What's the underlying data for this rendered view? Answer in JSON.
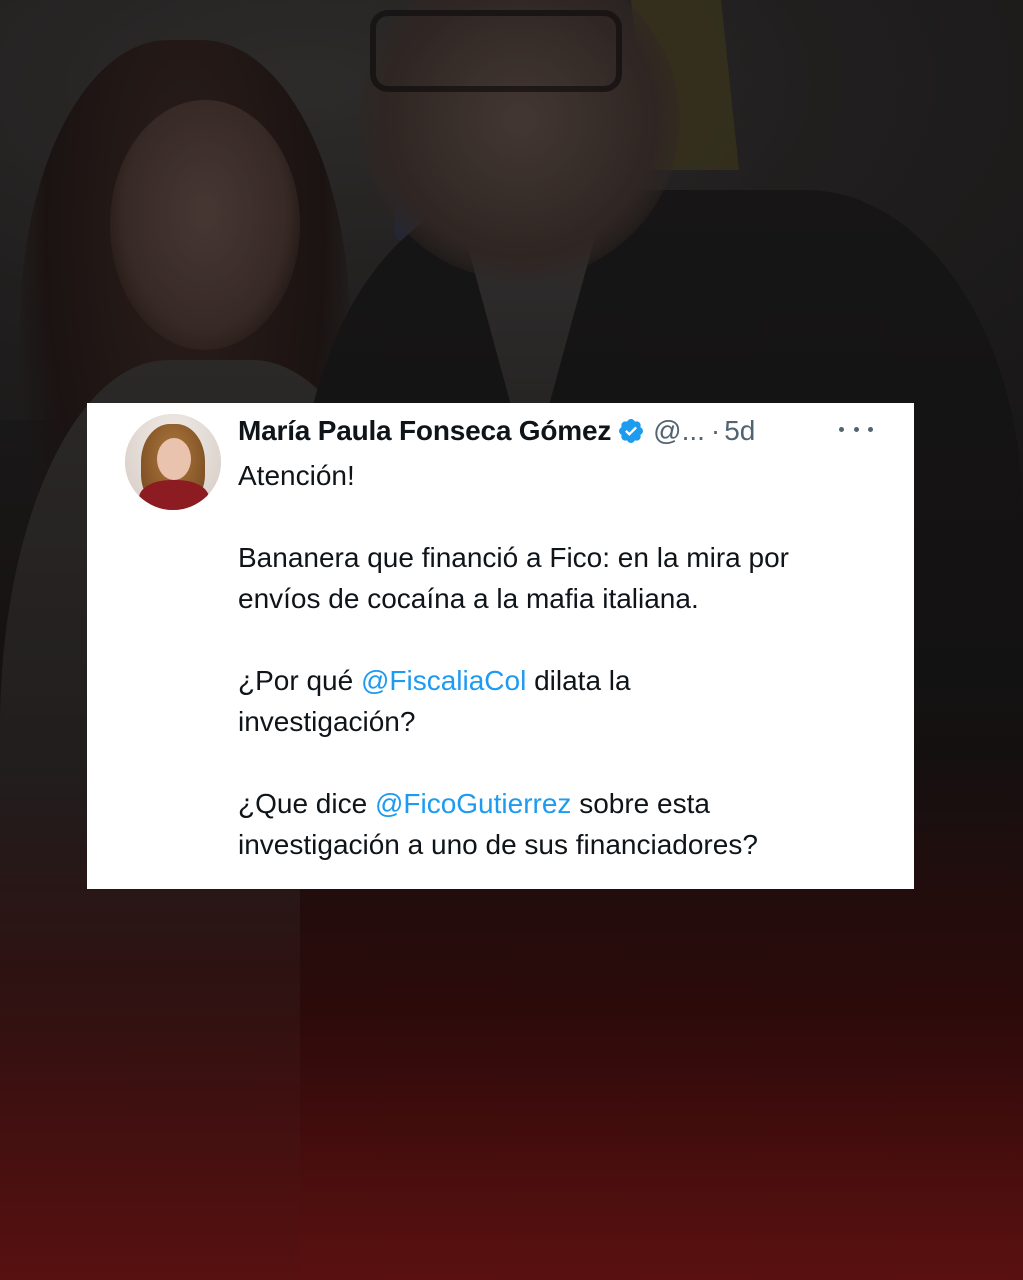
{
  "tweet": {
    "author_name": "María Paula Fonseca Gómez",
    "handle": "@...",
    "separator": "·",
    "time": "5d",
    "paragraphs": {
      "p1": "Atención!",
      "p2_line1": "Bananera que financió a Fico: en la mira por",
      "p2_line2": "envíos de cocaína a la mafia italiana.",
      "p3_pre": "¿Por qué ",
      "p3_mention": "@FiscaliaCol",
      "p3_post": " dilata la",
      "p3_line2": "investigación?",
      "p4_pre": "¿Que dice ",
      "p4_mention": "@FicoGutierrez",
      "p4_post": " sobre esta",
      "p4_line2": "investigación a uno de sus financiadores?"
    },
    "icons": {
      "verified": "verified-badge-icon",
      "more": "more-options-icon"
    }
  },
  "colors": {
    "text": "#0f1419",
    "muted": "#536471",
    "mention": "#1d9bf0",
    "verified": "#1d9bf0",
    "card": "#ffffff",
    "background_bottom": "#5a1414"
  }
}
